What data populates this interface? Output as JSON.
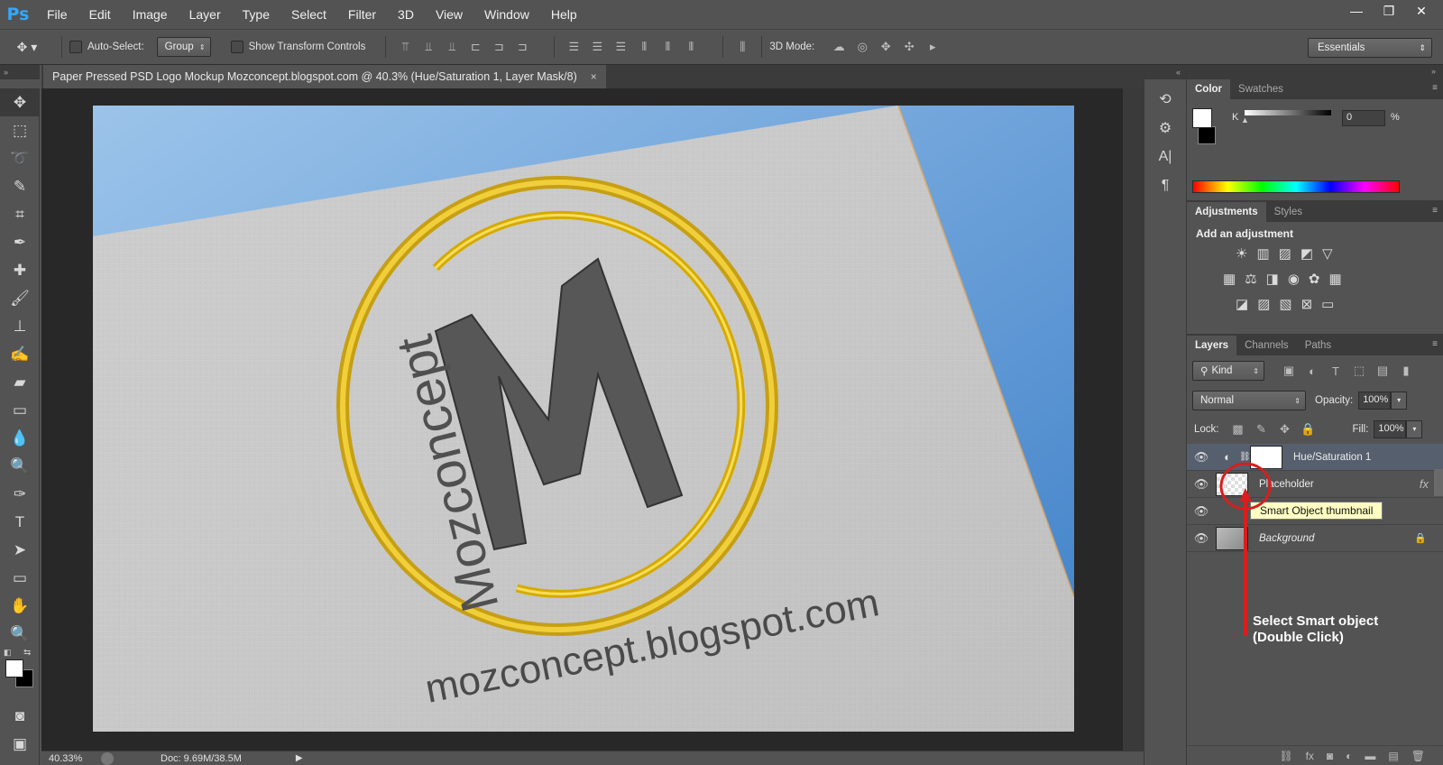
{
  "app": {
    "logo": "Ps"
  },
  "menu": [
    "File",
    "Edit",
    "Image",
    "Layer",
    "Type",
    "Select",
    "Filter",
    "3D",
    "View",
    "Window",
    "Help"
  ],
  "window_controls": {
    "minimize": "—",
    "restore": "❐",
    "close": "✕"
  },
  "options": {
    "auto_select_label": "Auto-Select:",
    "auto_select_value": "Group",
    "show_transform_label": "Show Transform Controls",
    "mode_3d_label": "3D Mode:",
    "workspace": "Essentials"
  },
  "document": {
    "tab_title": "Paper Pressed PSD Logo Mockup Mozconcept.blogspot.com @ 40.3% (Hue/Saturation 1, Layer Mask/8)",
    "close": "×",
    "canvas": {
      "logo_letter": "M",
      "logo_arc_text": "Mozconcept",
      "url_text": "mozconcept.blogspot.com"
    }
  },
  "status": {
    "zoom": "40.33%",
    "doc": "Doc: 9.69M/38.5M"
  },
  "color_panel": {
    "tabs": [
      "Color",
      "Swatches"
    ],
    "channel_label": "K",
    "value": "0",
    "unit": "%"
  },
  "adjustments_panel": {
    "tabs": [
      "Adjustments",
      "Styles"
    ],
    "heading": "Add an adjustment"
  },
  "layers_panel": {
    "tabs": [
      "Layers",
      "Channels",
      "Paths"
    ],
    "filter_kind": "Kind",
    "blend_mode": "Normal",
    "opacity_label": "Opacity:",
    "opacity_value": "100%",
    "lock_label": "Lock:",
    "fill_label": "Fill:",
    "fill_value": "100%",
    "layers": [
      {
        "name": "Hue/Saturation 1"
      },
      {
        "name": "Placeholder",
        "fx": "fx"
      },
      {
        "name": ""
      },
      {
        "name": "Background"
      }
    ],
    "tooltip": "Smart Object thumbnail"
  },
  "annotation": {
    "line1": "Select Smart object",
    "line2": "(Double Click)",
    "color": "#d81e1e"
  },
  "colors": {
    "panel_bg": "#535353",
    "dark_bg": "#282828",
    "selected_layer": "#565f6d",
    "logo_gold": "#e0b400",
    "sky_blue": "#5f9ed9"
  }
}
